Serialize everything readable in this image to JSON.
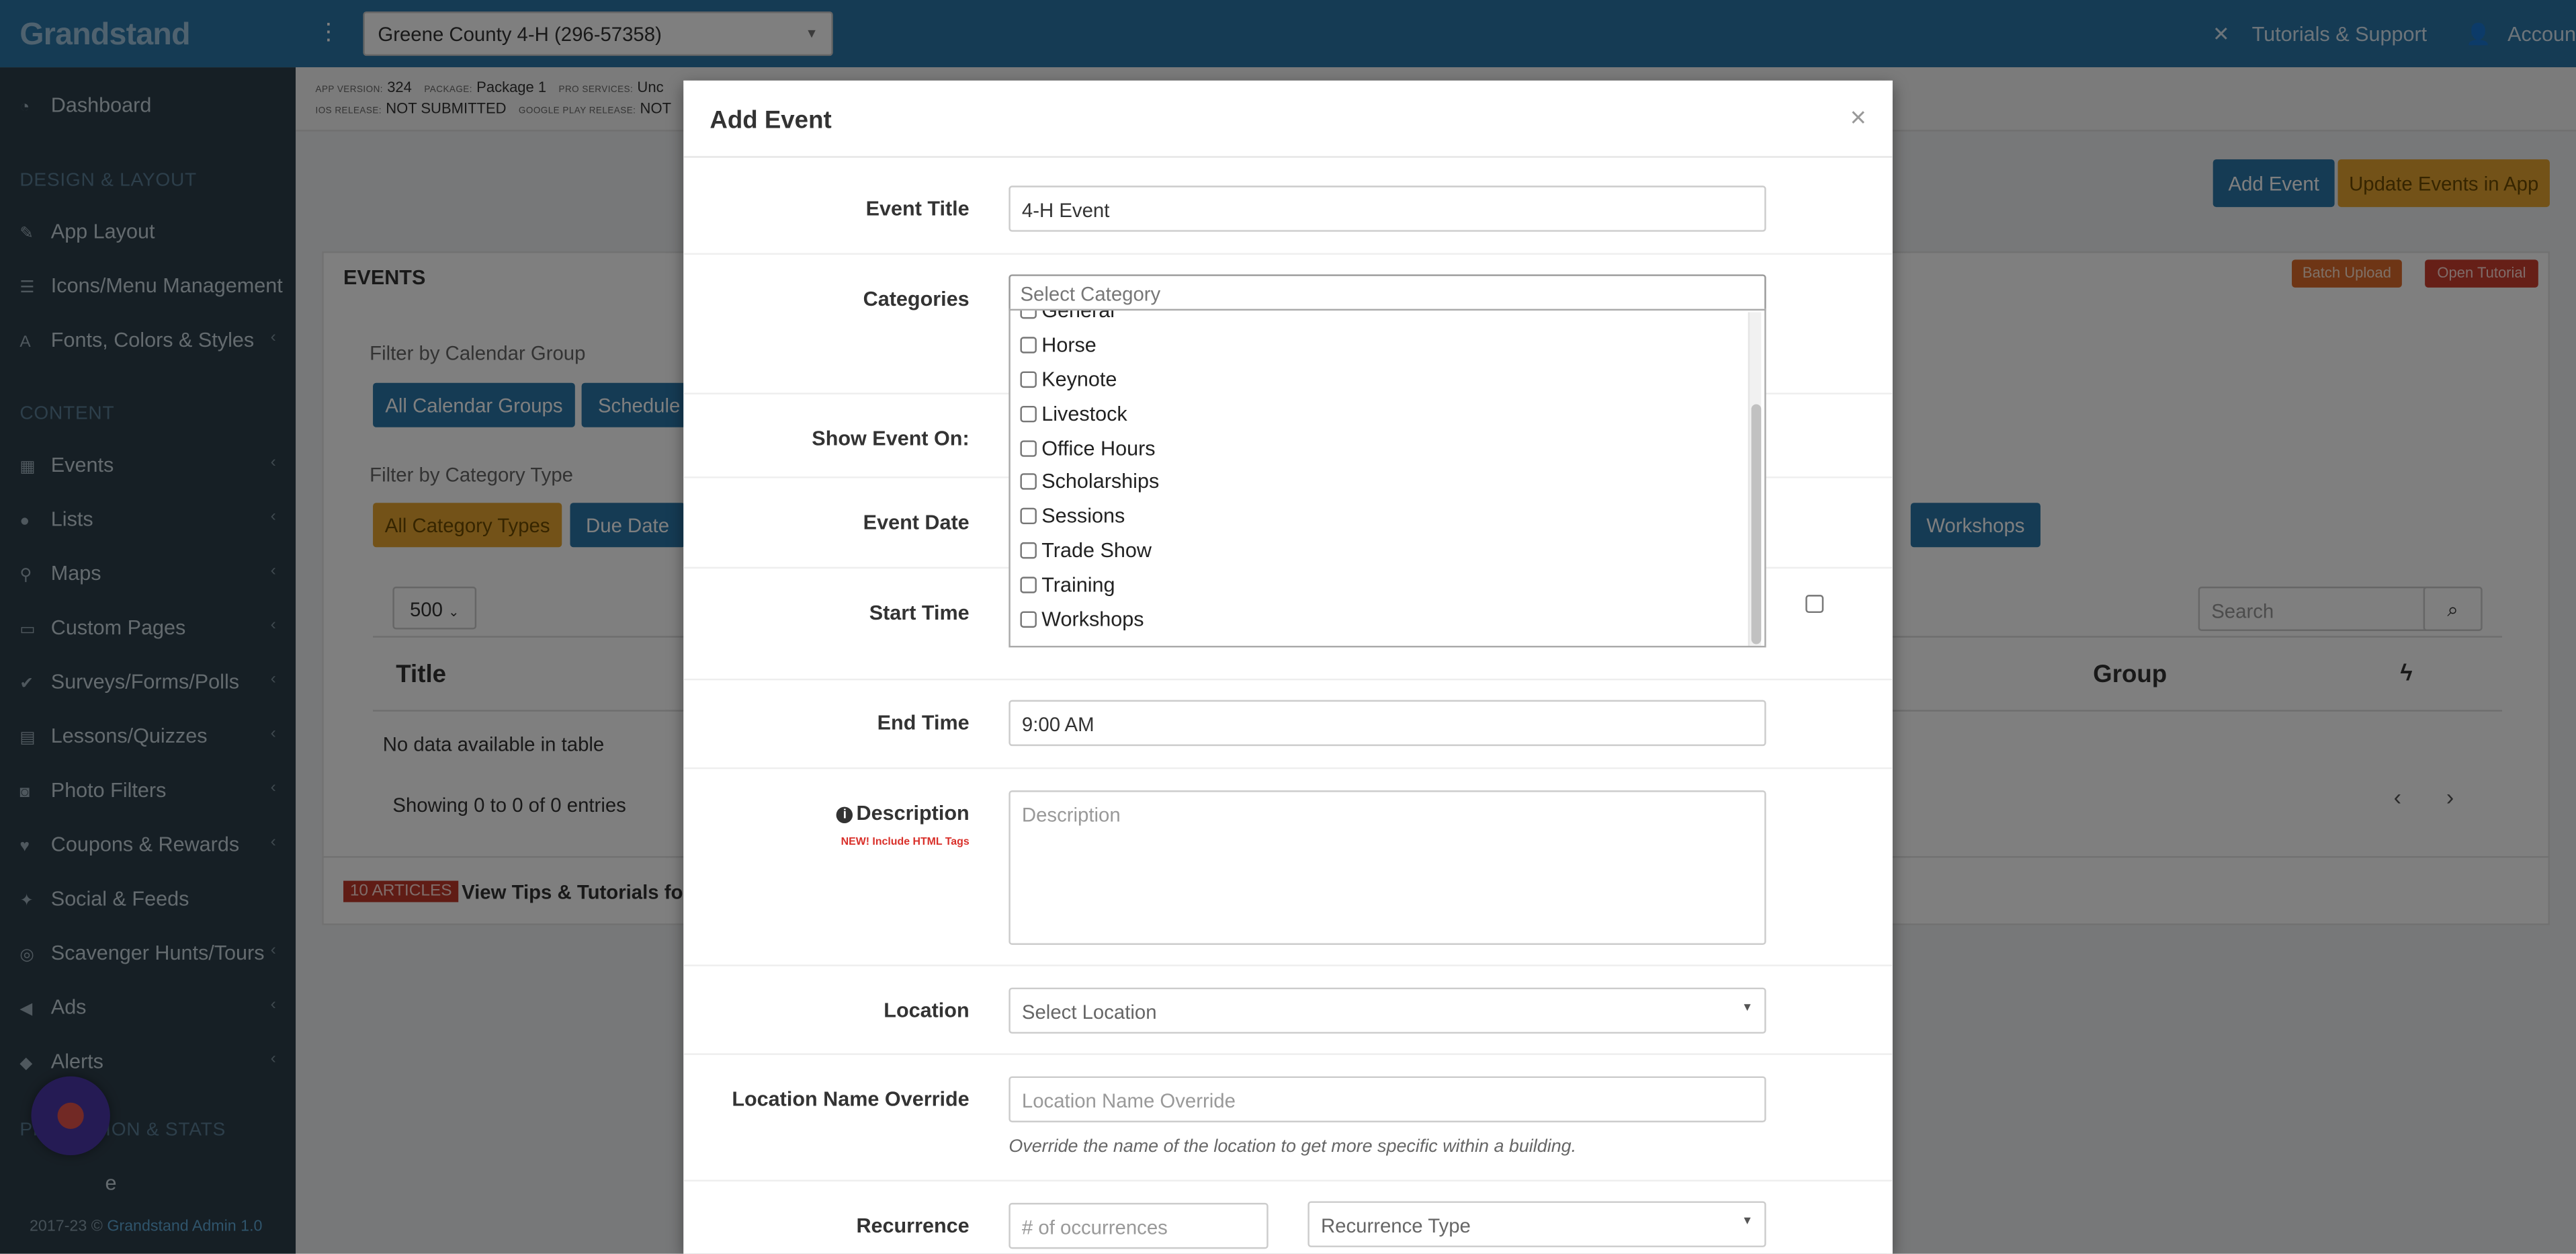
{
  "topbar": {
    "brand": "Grandstand",
    "org_select_value": "Greene County 4-H (296-57358)",
    "tutorials_label": "Tutorials & Support",
    "account_label": "Accoun"
  },
  "sidebar": {
    "items": [
      {
        "label": "Dashboard",
        "icon": "dashboard-icon"
      },
      {
        "label": "App Layout",
        "icon": "brush-icon"
      },
      {
        "label": "Icons/Menu Management",
        "icon": "menu-icon"
      },
      {
        "label": "Fonts, Colors & Styles",
        "icon": "font-icon"
      },
      {
        "label": "Events",
        "icon": "calendar-icon"
      },
      {
        "label": "Lists",
        "icon": "users-icon"
      },
      {
        "label": "Maps",
        "icon": "map-marker-icon"
      },
      {
        "label": "Custom Pages",
        "icon": "file-icon"
      },
      {
        "label": "Surveys/Forms/Polls",
        "icon": "check-icon"
      },
      {
        "label": "Lessons/Quizzes",
        "icon": "book-icon"
      },
      {
        "label": "Photo Filters",
        "icon": "camera-icon"
      },
      {
        "label": "Coupons & Rewards",
        "icon": "heart-icon"
      },
      {
        "label": "Social & Feeds",
        "icon": "twitter-icon"
      },
      {
        "label": "Scavenger Hunts/Tours",
        "icon": "compass-icon"
      },
      {
        "label": "Ads",
        "icon": "megaphone-icon"
      },
      {
        "label": "Alerts",
        "icon": "bell-icon"
      },
      {
        "label": "e",
        "icon": "chart-icon"
      }
    ],
    "section_design": "DESIGN & LAYOUT",
    "section_content": "CONTENT",
    "section_promo": "PROMOTION & STATS",
    "footer_text": "2017-23 © ",
    "footer_link": "Grandstand Admin 1.0"
  },
  "main": {
    "status": {
      "app_version_key": "APP VERSION:",
      "app_version_val": "324",
      "package_key": "PACKAGE:",
      "package_val": "Package 1",
      "pro_key": "PRO SERVICES:",
      "pro_val": "Unc",
      "ios_key": "IOS RELEASE:",
      "ios_val": "NOT SUBMITTED",
      "gp_key": "GOOGLE PLAY RELEASE:",
      "gp_val": "NOT"
    },
    "add_event_btn": "Add Event",
    "update_events_btn": "Update Events in App",
    "panel_title": "EVENTS",
    "batch_upload": "Batch Upload",
    "open_tutorial": "Open Tutorial",
    "filter_calendar_label": "Filter by Calendar Group",
    "all_calendar_groups": "All Calendar Groups",
    "schedule_btn": "Schedule",
    "filter_category_label": "Filter by Category Type",
    "all_category_types": "All Category Types",
    "due_date_btn": "Due Date",
    "workshops_btn": "Workshops",
    "page_length": "500",
    "search_placeholder": "Search",
    "col_title": "Title",
    "col_group": "Group",
    "no_data": "No data available in table",
    "showing": "Showing 0 to 0 of 0 entries",
    "articles_badge": "10 ARTICLES",
    "articles_text": "View Tips & Tutorials for E"
  },
  "modal": {
    "title": "Add Event",
    "event_title_label": "Event Title",
    "event_title_value": "4-H Event",
    "categories_label": "Categories",
    "categories_placeholder": "Select Category",
    "category_options": [
      "General",
      "Horse",
      "Keynote",
      "Livestock",
      "Office Hours",
      "Scholarships",
      "Sessions",
      "Trade Show",
      "Training",
      "Workshops"
    ],
    "show_event_on_label": "Show Event On:",
    "event_date_label": "Event Date",
    "start_time_label": "Start Time",
    "end_time_label": "End Time",
    "end_time_value": "9:00 AM",
    "description_label": "Description",
    "description_new_tag": "NEW! Include HTML Tags",
    "description_placeholder": "Description",
    "location_label": "Location",
    "location_placeholder": "Select Location",
    "location_override_label": "Location Name Override",
    "location_override_placeholder": "Location Name Override",
    "location_override_help": "Override the name of the location to get more specific within a building.",
    "recurrence_label": "Recurrence",
    "recurrence_count_placeholder": "# of occurrences",
    "recurrence_type_placeholder": "Recurrence Type"
  }
}
